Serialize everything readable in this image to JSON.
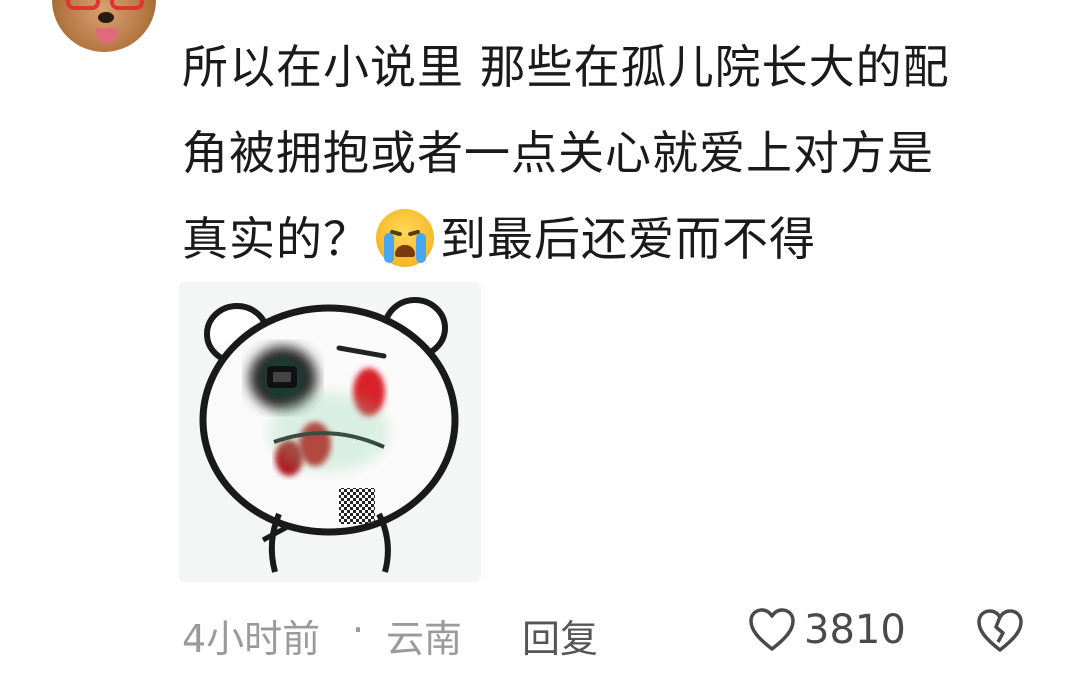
{
  "comment": {
    "line1": "所以在小说里 那些在孤儿院长大的配",
    "line2": "角被拥抱或者一点关心就爱上对方是",
    "line3_before": "真实的？",
    "line3_emoji": "crying-face-icon",
    "line3_after": "到最后还爱而不得"
  },
  "footer": {
    "time": "4小时前",
    "separator": "·",
    "location": "云南",
    "reply_label": "回复",
    "like_count": "3810"
  },
  "icons": {
    "like": "heart-outline-icon",
    "dislike": "broken-heart-icon"
  }
}
